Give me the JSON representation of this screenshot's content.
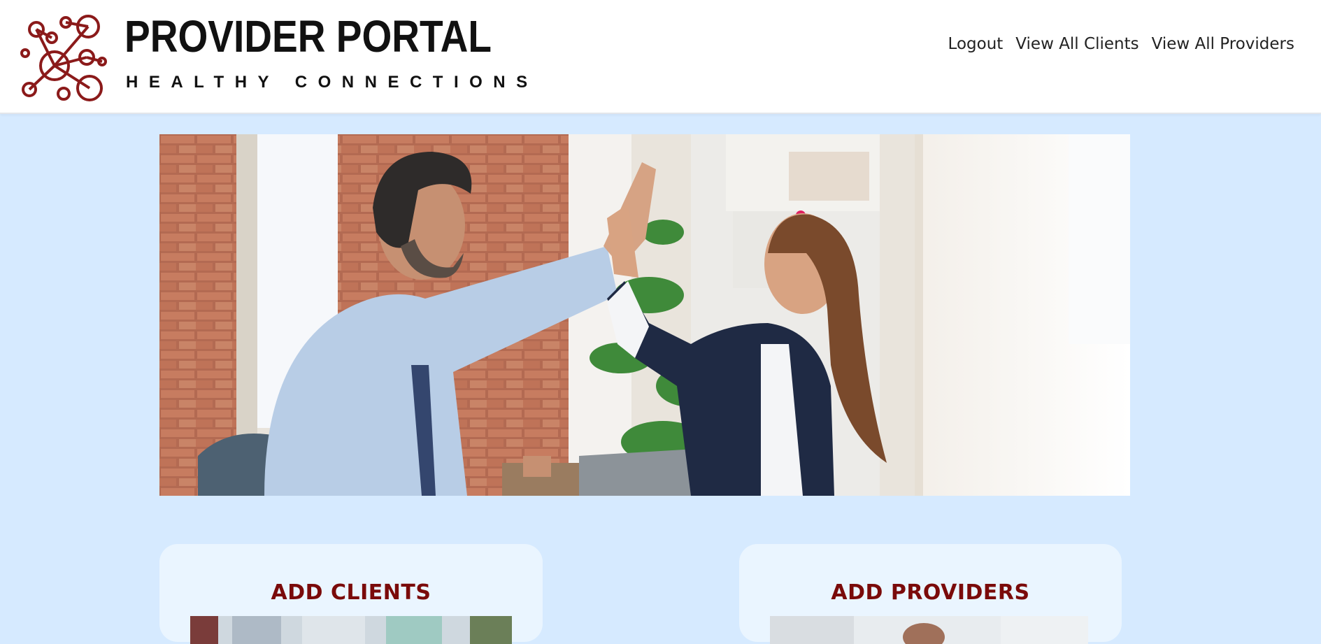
{
  "brand": {
    "title": "PROVIDER PORTAL",
    "subtitle": "HEALTHY CONNECTIONS",
    "logo_icon": "network-nodes-icon",
    "logo_color": "#8b1a1a"
  },
  "nav": {
    "logout": "Logout",
    "view_clients": "View All Clients",
    "view_providers": "View All Providers"
  },
  "hero": {
    "image": "photo-colleagues-high-five"
  },
  "cards": {
    "add_clients": {
      "title": "ADD CLIENTS",
      "image": "photo-clients"
    },
    "add_providers": {
      "title": "ADD PROVIDERS",
      "image": "photo-providers"
    }
  },
  "colors": {
    "page_background": "#d6eaff",
    "card_background": "#eaf5ff",
    "card_title": "#7a0a0a",
    "header_background": "#ffffff"
  }
}
